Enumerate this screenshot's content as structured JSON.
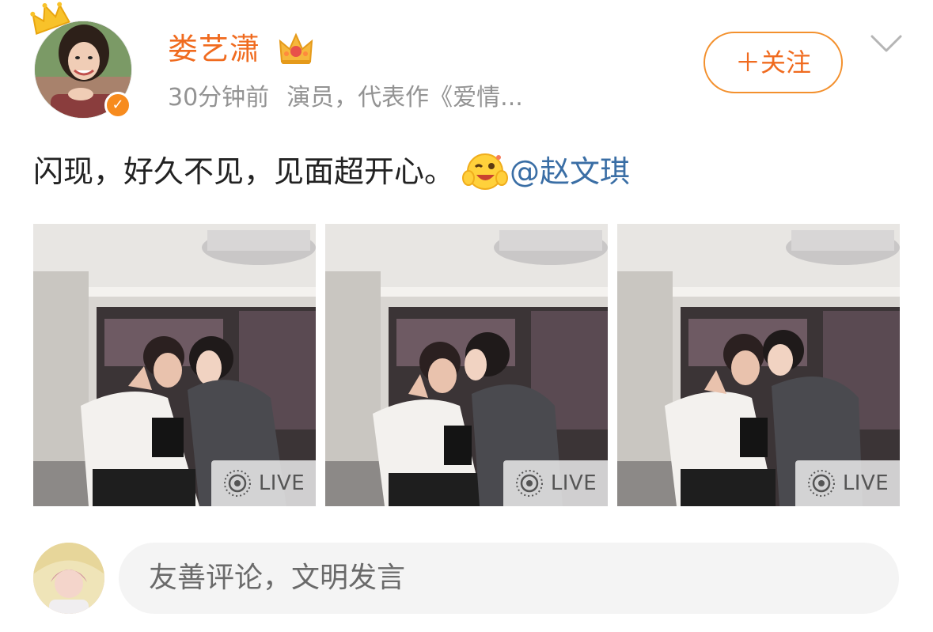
{
  "post": {
    "username": "娄艺潇",
    "time": "30分钟前",
    "bio": "演员，代表作《爱情...",
    "follow_label": "＋关注",
    "text": "闪现，好久不见，见面超开心。",
    "mention": "@赵文琪",
    "photos": [
      {
        "live_label": "LIVE"
      },
      {
        "live_label": "LIVE"
      },
      {
        "live_label": "LIVE"
      }
    ]
  },
  "comment": {
    "placeholder": "友善评论，文明发言"
  },
  "colors": {
    "username": "#f06b1f",
    "follow_border": "#f3902d",
    "mention": "#3a6ea5",
    "meta": "#939393",
    "verified": "#f78b1e"
  },
  "icons": {
    "crown": "crown-icon",
    "verified": "verified-icon",
    "vip": "vip-crown-icon",
    "chevron": "chevron-down-icon",
    "emoji": "wink-emoji-icon",
    "live": "live-photo-icon"
  }
}
